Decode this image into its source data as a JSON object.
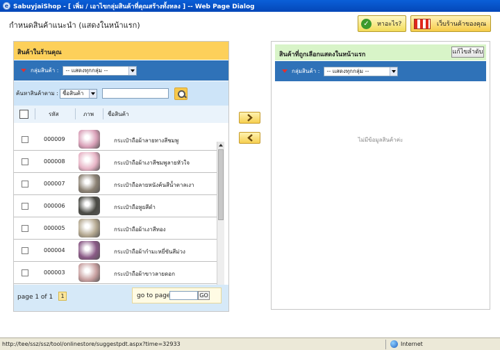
{
  "window": {
    "title": "SabuyjaiShop - [ เพิ่ม / เอาไขกลุ่มสินค้าที่คุณสร้างทั้งหลง ] -- Web Page Dialog"
  },
  "header": {
    "page_title": "กำหนดสินค้าแนะนำ (แสดงในหน้าแรก)",
    "help_label": "หาอะไร?",
    "store_label": "เว็บร้านค้าของคุณ"
  },
  "left_panel": {
    "title": "สินค้าในร้านคุณ",
    "group_label": "กลุ่มสินค้า :",
    "group_select": "-- แสดงทุกกลุ่ม --",
    "search_label": "ค้นหาสินค้าตาม :",
    "search_by": "ชื่อสินค้า",
    "search_value": "",
    "columns": {
      "code": "รหัส",
      "picture": "ภาพ",
      "name": "ชื่อสินค้า"
    },
    "rows": [
      {
        "code": "000009",
        "name": "กระเป๋าถือผ้าลายทางสีชมพู",
        "color": "#d9a0b8"
      },
      {
        "code": "000008",
        "name": "กระเป๋าถือผ้าเงาสีชมพูลายหัวใจ",
        "color": "#e7b4c6"
      },
      {
        "code": "000007",
        "name": "กระเป๋าถือลายหนังค้นสีน้ำตาลเงา",
        "color": "#8c8274"
      },
      {
        "code": "000006",
        "name": "กระเป๋าถือหูยสีดำ",
        "color": "#4a4a44"
      },
      {
        "code": "000005",
        "name": "กระเป๋าถือผ้าเงาสีทอง",
        "color": "#b4a890"
      },
      {
        "code": "000004",
        "name": "กระเป๋าถือผ้ากำมะหยี่ขันสีม่วง",
        "color": "#8a5a86"
      },
      {
        "code": "000003",
        "name": "กระเป๋าถือผ้าขาวลายดอก",
        "color": "#c8a0a0"
      }
    ],
    "pagination": {
      "info": "page 1 of 1",
      "current_page": "1",
      "goto_label": "go to page",
      "goto_value": "",
      "go_button": "GO"
    }
  },
  "right_panel": {
    "title": "สินค้าที่ถูกเลือกแสดงในหน้าแรก",
    "reorder_button": "แก้ไขลำดับ",
    "group_label": "กลุ่มสินค้า :",
    "group_select": "-- แสดงทุกกลุ่ม --",
    "empty_message": "ไม่มีข้อมูลสินค้าค่ะ"
  },
  "statusbar": {
    "url": "http://tee/ssz/ssz/tool/onlinestore/suggestpdt.aspx?time=32933",
    "zone": "Internet"
  },
  "colors": {
    "accent_yellow": "#fdd05a",
    "nav_blue": "#2f72b8",
    "title_blue": "#0a5fd8"
  }
}
